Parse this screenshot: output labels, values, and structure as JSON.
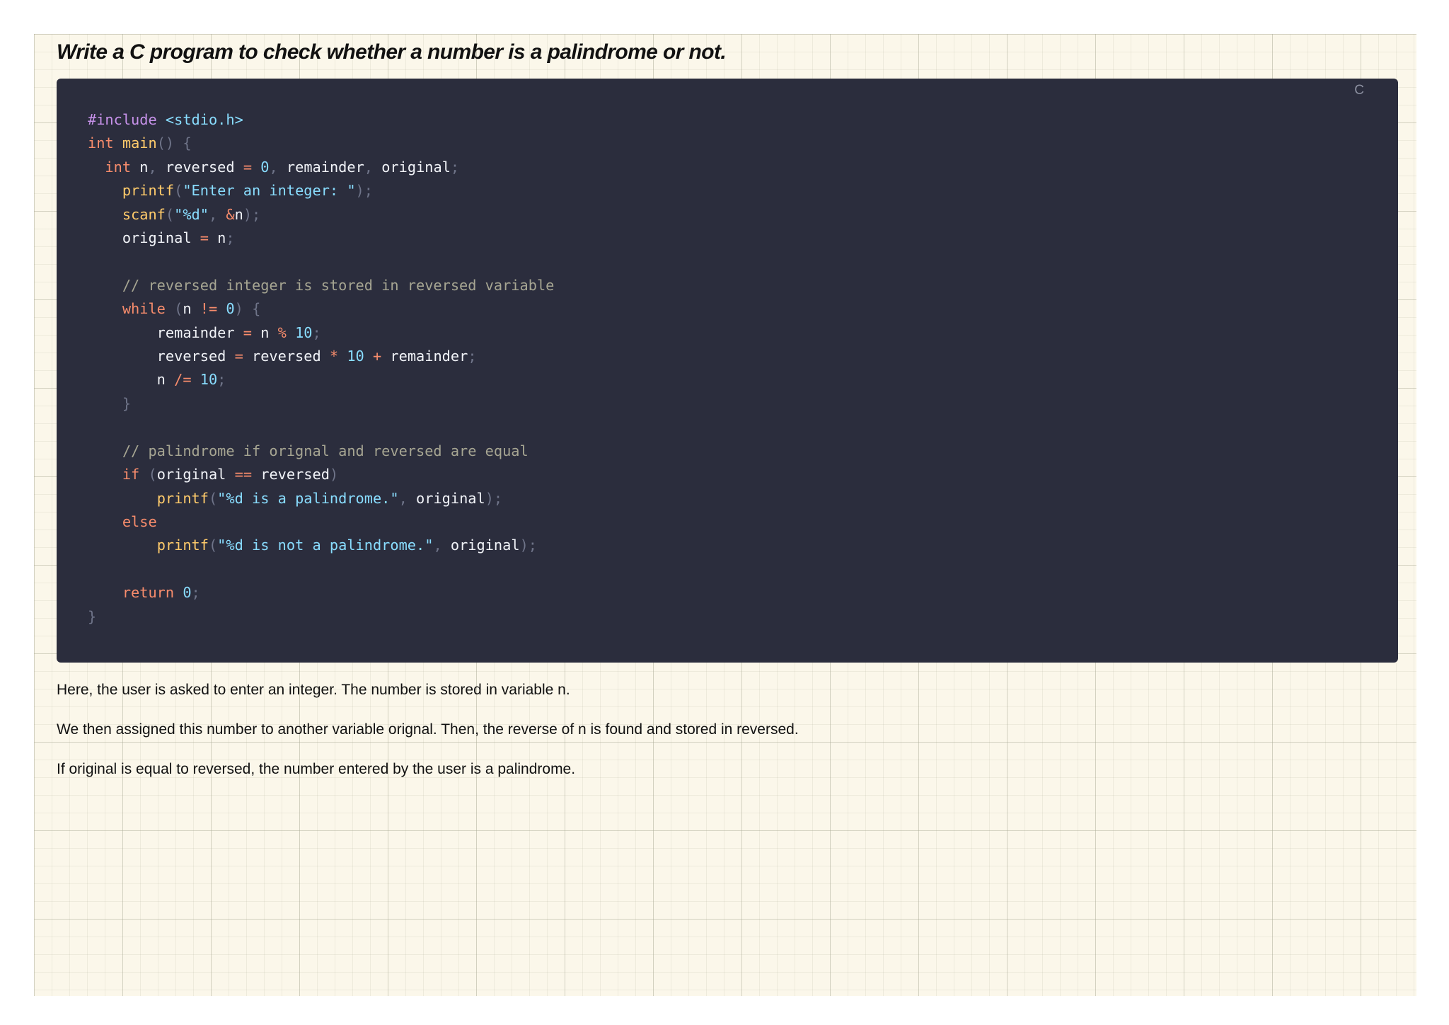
{
  "heading": "Write a C program to check whether a number is a palindrome or not.",
  "code_block": {
    "language": "C",
    "lines": [
      [
        [
          "pp",
          "#include"
        ],
        [
          "tx",
          " "
        ],
        [
          "st",
          "<stdio.h>"
        ]
      ],
      [
        [
          "kw",
          "int"
        ],
        [
          "tx",
          " "
        ],
        [
          "fn",
          "main"
        ],
        [
          "pu",
          "()"
        ],
        [
          "tx",
          " "
        ],
        [
          "pu",
          "{"
        ]
      ],
      [
        [
          "tx",
          "  "
        ],
        [
          "kw",
          "int"
        ],
        [
          "tx",
          " n"
        ],
        [
          "pu",
          ","
        ],
        [
          "tx",
          " reversed "
        ],
        [
          "op",
          "="
        ],
        [
          "tx",
          " "
        ],
        [
          "nu",
          "0"
        ],
        [
          "pu",
          ","
        ],
        [
          "tx",
          " remainder"
        ],
        [
          "pu",
          ","
        ],
        [
          "tx",
          " original"
        ],
        [
          "pu",
          ";"
        ]
      ],
      [
        [
          "tx",
          "    "
        ],
        [
          "fn",
          "printf"
        ],
        [
          "pu",
          "("
        ],
        [
          "st",
          "\"Enter an integer: \""
        ],
        [
          "pu",
          ");"
        ]
      ],
      [
        [
          "tx",
          "    "
        ],
        [
          "fn",
          "scanf"
        ],
        [
          "pu",
          "("
        ],
        [
          "st",
          "\"%d\""
        ],
        [
          "pu",
          ","
        ],
        [
          "tx",
          " "
        ],
        [
          "op",
          "&"
        ],
        [
          "tx",
          "n"
        ],
        [
          "pu",
          ");"
        ]
      ],
      [
        [
          "tx",
          "    original "
        ],
        [
          "op",
          "="
        ],
        [
          "tx",
          " n"
        ],
        [
          "pu",
          ";"
        ]
      ],
      [],
      [
        [
          "tx",
          "    "
        ],
        [
          "cm",
          "// reversed integer is stored in reversed variable"
        ]
      ],
      [
        [
          "tx",
          "    "
        ],
        [
          "kw",
          "while"
        ],
        [
          "tx",
          " "
        ],
        [
          "pu",
          "("
        ],
        [
          "tx",
          "n "
        ],
        [
          "op",
          "!="
        ],
        [
          "tx",
          " "
        ],
        [
          "nu",
          "0"
        ],
        [
          "pu",
          ")"
        ],
        [
          "tx",
          " "
        ],
        [
          "pu",
          "{"
        ]
      ],
      [
        [
          "tx",
          "        remainder "
        ],
        [
          "op",
          "="
        ],
        [
          "tx",
          " n "
        ],
        [
          "op",
          "%"
        ],
        [
          "tx",
          " "
        ],
        [
          "nu",
          "10"
        ],
        [
          "pu",
          ";"
        ]
      ],
      [
        [
          "tx",
          "        reversed "
        ],
        [
          "op",
          "="
        ],
        [
          "tx",
          " reversed "
        ],
        [
          "op",
          "*"
        ],
        [
          "tx",
          " "
        ],
        [
          "nu",
          "10"
        ],
        [
          "tx",
          " "
        ],
        [
          "op",
          "+"
        ],
        [
          "tx",
          " remainder"
        ],
        [
          "pu",
          ";"
        ]
      ],
      [
        [
          "tx",
          "        n "
        ],
        [
          "op",
          "/="
        ],
        [
          "tx",
          " "
        ],
        [
          "nu",
          "10"
        ],
        [
          "pu",
          ";"
        ]
      ],
      [
        [
          "tx",
          "    "
        ],
        [
          "pu",
          "}"
        ]
      ],
      [],
      [
        [
          "tx",
          "    "
        ],
        [
          "cm",
          "// palindrome if orignal and reversed are equal"
        ]
      ],
      [
        [
          "tx",
          "    "
        ],
        [
          "kw",
          "if"
        ],
        [
          "tx",
          " "
        ],
        [
          "pu",
          "("
        ],
        [
          "tx",
          "original "
        ],
        [
          "op",
          "=="
        ],
        [
          "tx",
          " reversed"
        ],
        [
          "pu",
          ")"
        ]
      ],
      [
        [
          "tx",
          "        "
        ],
        [
          "fn",
          "printf"
        ],
        [
          "pu",
          "("
        ],
        [
          "st",
          "\"%d is a palindrome.\""
        ],
        [
          "pu",
          ","
        ],
        [
          "tx",
          " original"
        ],
        [
          "pu",
          ");"
        ]
      ],
      [
        [
          "tx",
          "    "
        ],
        [
          "kw",
          "else"
        ]
      ],
      [
        [
          "tx",
          "        "
        ],
        [
          "fn",
          "printf"
        ],
        [
          "pu",
          "("
        ],
        [
          "st",
          "\"%d is not a palindrome.\""
        ],
        [
          "pu",
          ","
        ],
        [
          "tx",
          " original"
        ],
        [
          "pu",
          ");"
        ]
      ],
      [],
      [
        [
          "tx",
          "    "
        ],
        [
          "kw",
          "return"
        ],
        [
          "tx",
          " "
        ],
        [
          "nu",
          "0"
        ],
        [
          "pu",
          ";"
        ]
      ],
      [
        [
          "pu",
          "}"
        ]
      ]
    ]
  },
  "paragraphs": [
    "Here, the user is asked to enter an integer. The number is stored in variable n.",
    "We then assigned this number to another variable orignal. Then, the reverse of n is found and stored in reversed.",
    "If original is equal to reversed, the number entered by the user is a palindrome."
  ]
}
